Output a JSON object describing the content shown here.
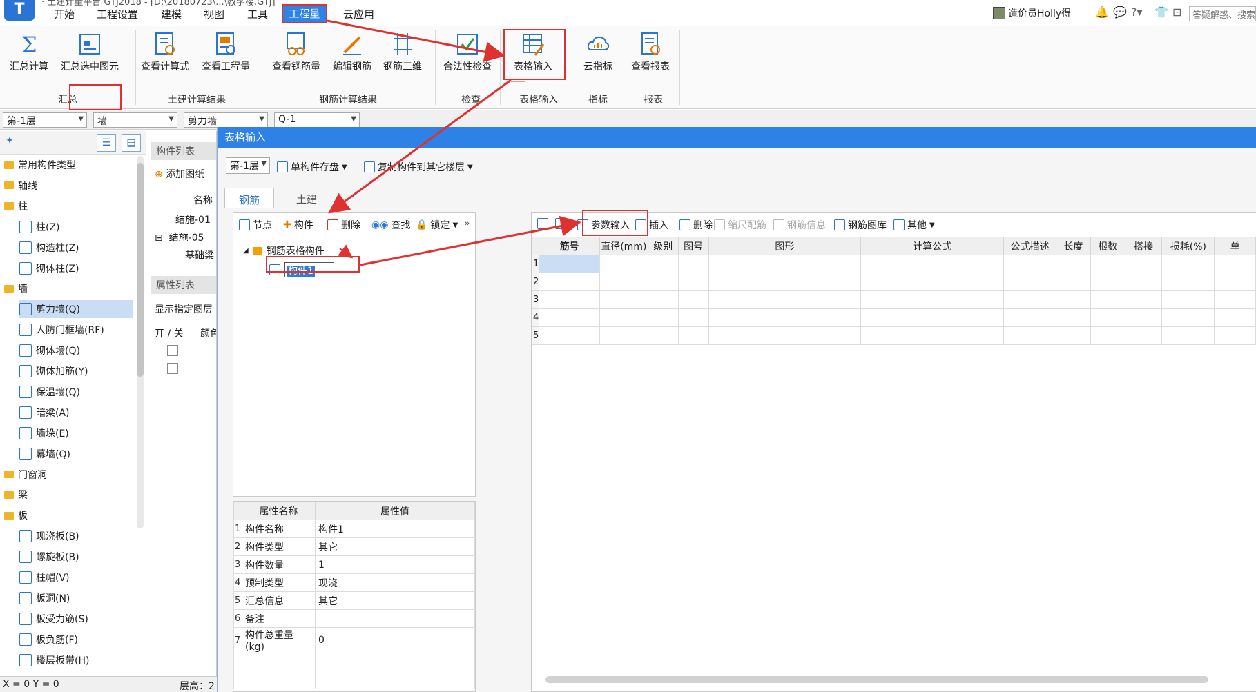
{
  "titlebar": {
    "title_fragment": "· 土建计量平台 GTJ2018 - [D:\\20180723\\...\\教学楼.GTJ]",
    "menu": [
      "开始",
      "工程设置",
      "建模",
      "视图",
      "工具",
      "工程量",
      "云应用"
    ],
    "active_menu": "工程量",
    "user_name": "造价员Holly得",
    "search_placeholder": "答疑解惑、搜索"
  },
  "ribbon": {
    "groups": [
      {
        "label": "汇总",
        "buttons": [
          "汇总计算",
          "汇总选中图元"
        ]
      },
      {
        "label": "土建计算结果",
        "buttons": [
          "查看计算式",
          "查看工程量"
        ]
      },
      {
        "label": "钢筋计算结果",
        "buttons": [
          "查看钢筋量",
          "编辑钢筋",
          "钢筋三维"
        ]
      },
      {
        "label": "检查",
        "buttons": [
          "合法性检查"
        ]
      },
      {
        "label": "表格输入",
        "buttons": [
          "表格输入"
        ]
      },
      {
        "label": "指标",
        "buttons": [
          "云指标"
        ]
      },
      {
        "label": "报表",
        "buttons": [
          "查看报表"
        ]
      }
    ]
  },
  "selectors": [
    "第-1层",
    "墙",
    "剪力墙",
    "Q-1"
  ],
  "left_tree": [
    {
      "label": "常用构件类型",
      "type": "folder",
      "level": 0,
      "fold": "+"
    },
    {
      "label": "轴线",
      "type": "folder",
      "level": 0,
      "fold": "+"
    },
    {
      "label": "柱",
      "type": "folder",
      "level": 0,
      "fold": "−"
    },
    {
      "label": "柱(Z)",
      "type": "leaf",
      "level": 1
    },
    {
      "label": "构造柱(Z)",
      "type": "leaf",
      "level": 1
    },
    {
      "label": "砌体柱(Z)",
      "type": "leaf",
      "level": 1
    },
    {
      "label": "墙",
      "type": "folder",
      "level": 0,
      "fold": "−"
    },
    {
      "label": "剪力墙(Q)",
      "type": "leaf",
      "level": 1,
      "selected": true
    },
    {
      "label": "人防门框墙(RF)",
      "type": "leaf",
      "level": 1
    },
    {
      "label": "砌体墙(Q)",
      "type": "leaf",
      "level": 1
    },
    {
      "label": "砌体加筋(Y)",
      "type": "leaf",
      "level": 1
    },
    {
      "label": "保温墙(Q)",
      "type": "leaf",
      "level": 1
    },
    {
      "label": "暗梁(A)",
      "type": "leaf",
      "level": 1
    },
    {
      "label": "墙垛(E)",
      "type": "leaf",
      "level": 1
    },
    {
      "label": "幕墙(Q)",
      "type": "leaf",
      "level": 1
    },
    {
      "label": "门窗洞",
      "type": "folder",
      "level": 0,
      "fold": "+"
    },
    {
      "label": "梁",
      "type": "folder",
      "level": 0,
      "fold": "+"
    },
    {
      "label": "板",
      "type": "folder",
      "level": 0,
      "fold": "−"
    },
    {
      "label": "现浇板(B)",
      "type": "leaf",
      "level": 1
    },
    {
      "label": "螺旋板(B)",
      "type": "leaf",
      "level": 1
    },
    {
      "label": "柱帽(V)",
      "type": "leaf",
      "level": 1
    },
    {
      "label": "板洞(N)",
      "type": "leaf",
      "level": 1
    },
    {
      "label": "板受力筋(S)",
      "type": "leaf",
      "level": 1
    },
    {
      "label": "板负筋(F)",
      "type": "leaf",
      "level": 1
    },
    {
      "label": "楼层板带(H)",
      "type": "leaf",
      "level": 1
    }
  ],
  "mid_panel": {
    "component_list_header": "构件列表",
    "add_drawing": "添加图纸",
    "name_header": "名称",
    "items": [
      "结施-01",
      "结施-05",
      "基础梁"
    ],
    "attr_list_header": "属性列表",
    "show_layer": "显示指定图层",
    "on_off": "开 / 关",
    "color": "颜色"
  },
  "dialog": {
    "title": "表格输入",
    "floor_select": "第-1层",
    "toolbar": [
      "单构件存盘",
      "复制构件到其它楼层"
    ],
    "tabs": [
      "钢筋",
      "土建"
    ],
    "tree_toolbar": [
      "节点",
      "构件",
      "删除",
      "查找",
      "锁定"
    ],
    "tree_root": "钢筋表格构件",
    "tree_child": "构件1",
    "prop_headers": [
      "属性名称",
      "属性值"
    ],
    "props": [
      {
        "n": "1",
        "name": "构件名称",
        "value": "构件1"
      },
      {
        "n": "2",
        "name": "构件类型",
        "value": "其它"
      },
      {
        "n": "3",
        "name": "构件数量",
        "value": "1"
      },
      {
        "n": "4",
        "name": "预制类型",
        "value": "现浇"
      },
      {
        "n": "5",
        "name": "汇总信息",
        "value": "其它"
      },
      {
        "n": "6",
        "name": "备注",
        "value": ""
      },
      {
        "n": "7",
        "name": "构件总重量(kg)",
        "value": "0"
      }
    ],
    "grid_toolbar": [
      {
        "label": "参数输入",
        "enabled": true
      },
      {
        "label": "插入",
        "enabled": true
      },
      {
        "label": "删除",
        "enabled": true
      },
      {
        "label": "缩尺配筋",
        "enabled": false
      },
      {
        "label": "钢筋信息",
        "enabled": false
      },
      {
        "label": "钢筋图库",
        "enabled": true
      },
      {
        "label": "其他",
        "enabled": true
      }
    ],
    "grid_headers": [
      "",
      "筋号",
      "直径(mm)",
      "级别",
      "图号",
      "图形",
      "计算公式",
      "公式描述",
      "长度",
      "根数",
      "搭接",
      "损耗(%)",
      "单"
    ],
    "grid_rows": [
      "1",
      "2",
      "3",
      "4",
      "5"
    ]
  },
  "status": {
    "xy": "X = 0 Y = 0",
    "floor_height": "层高：2"
  },
  "colors": {
    "accent": "#2e82e5",
    "highlight": "#e03131",
    "selection": "#c9ddf5"
  }
}
